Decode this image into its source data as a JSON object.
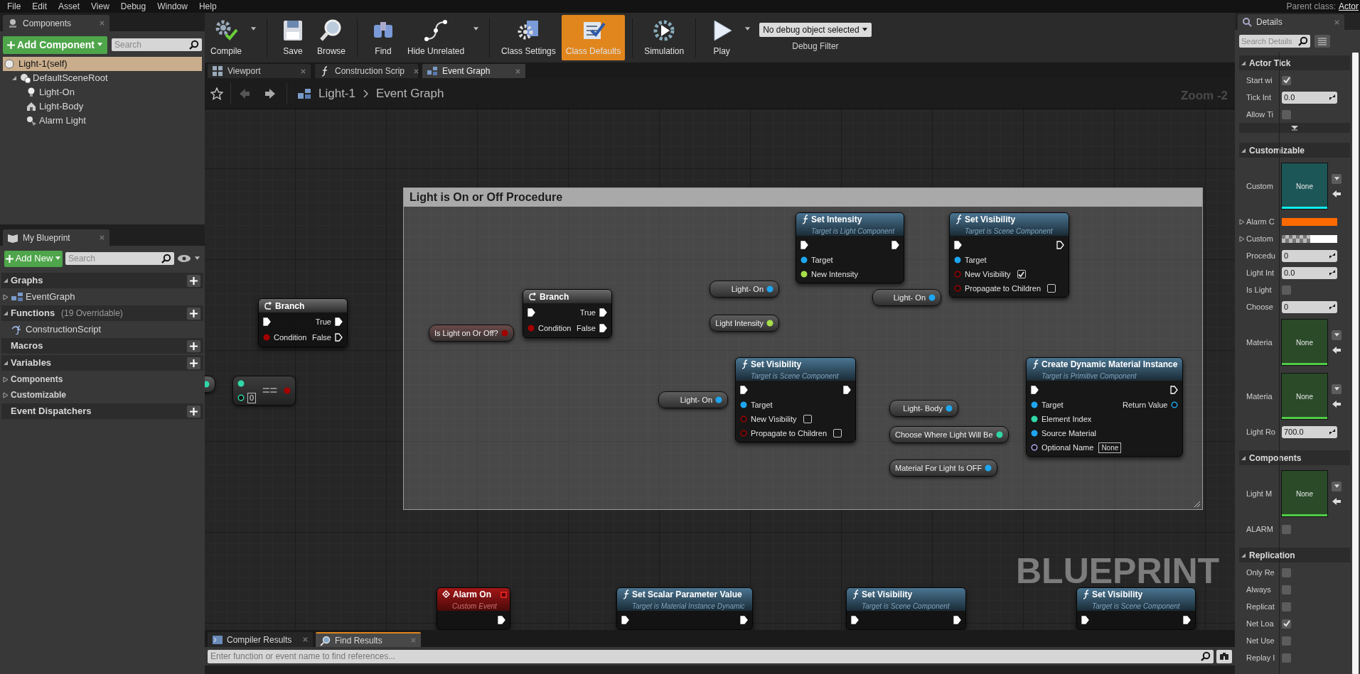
{
  "menu_bar": [
    "File",
    "Edit",
    "Asset",
    "View",
    "Debug",
    "Window",
    "Help"
  ],
  "parent_class": {
    "label": "Parent class:",
    "value": "Actor"
  },
  "components_panel": {
    "tab": "Components",
    "add_button": "Add Component",
    "search": {
      "placeholder": "Search"
    },
    "self_item": {
      "label": "Light-1(self)",
      "selected": true
    },
    "tree": [
      {
        "label": "DefaultSceneRoot",
        "kind": "scene",
        "expanded": true,
        "children": [
          {
            "label": "Light-On",
            "kind": "point_light"
          },
          {
            "label": "Light-Body",
            "kind": "mesh"
          },
          {
            "label": "Alarm Light",
            "kind": "spot_light"
          }
        ]
      }
    ]
  },
  "my_blueprint": {
    "tab": "My Blueprint",
    "add_button": "Add New",
    "search": {
      "placeholder": "Search"
    },
    "sections": [
      {
        "title": "Graphs",
        "items": [
          {
            "label": "EventGraph",
            "kind": "graph",
            "expandable": true
          }
        ]
      },
      {
        "title": "Functions",
        "note": "(19 Overridable)",
        "items": [
          {
            "label": "ConstructionScript",
            "kind": "function",
            "expandable": false
          }
        ]
      },
      {
        "title": "Macros"
      },
      {
        "title": "Variables",
        "items": [
          {
            "label": "Components",
            "kind": "category",
            "expandable": true
          },
          {
            "label": "Customizable",
            "kind": "category",
            "expandable": true
          }
        ]
      },
      {
        "title": "Event Dispatchers"
      }
    ]
  },
  "toolbar": [
    {
      "label": "Compile",
      "kind": "compile",
      "dropdown": true,
      "selected": false
    },
    {
      "label": "Save",
      "kind": "save",
      "dropdown": false,
      "selected": false
    },
    {
      "label": "Browse",
      "kind": "browse",
      "dropdown": false,
      "selected": false
    },
    {
      "label": "Find",
      "kind": "find",
      "dropdown": false,
      "selected": false
    },
    {
      "label": "Hide Unrelated",
      "kind": "hide",
      "dropdown": true,
      "selected": false
    },
    {
      "label": "Class Settings",
      "kind": "settings",
      "dropdown": false,
      "selected": false
    },
    {
      "label": "Class Defaults",
      "kind": "defaults",
      "dropdown": false,
      "selected": true
    },
    {
      "label": "Simulation",
      "kind": "simulation",
      "dropdown": false,
      "selected": false
    },
    {
      "label": "Play",
      "kind": "play",
      "dropdown": true,
      "selected": false
    }
  ],
  "debug_filter": {
    "value": "No debug object selected",
    "label": "Debug Filter"
  },
  "editor_tabs": [
    {
      "label": "Viewport",
      "kind": "viewport",
      "selected": false
    },
    {
      "label": "Construction Scrip",
      "kind": "function",
      "selected": false
    },
    {
      "label": "Event Graph",
      "kind": "graph",
      "selected": true
    }
  ],
  "breadcrumb": {
    "path": [
      "Light-1",
      "Event Graph"
    ],
    "zoom": "Zoom -2"
  },
  "graph": {
    "corner_label": "BLUEPRINT",
    "comment": {
      "title": "Light is On or Off Procedure"
    },
    "nodes": [
      {
        "kind": "variable",
        "outputs": [
          {
            "kind": "int",
            "connected": true
          }
        ]
      },
      {
        "kind": "branch",
        "title": "Branch",
        "inputs": [
          {
            "kind": "exec",
            "connected": true
          },
          {
            "label": "Condition",
            "kind": "bool",
            "connected": true
          }
        ],
        "outputs": [
          {
            "label": "True",
            "kind": "exec",
            "connected": true
          },
          {
            "label": "False",
            "kind": "exec",
            "connected": false
          }
        ]
      },
      {
        "kind": "compare",
        "symbol": "==",
        "inputs": [
          {
            "kind": "int",
            "connected": true
          },
          {
            "kind": "int",
            "connected": false,
            "value": "0"
          }
        ],
        "outputs": [
          {
            "kind": "bool",
            "connected": true
          }
        ]
      },
      {
        "kind": "variable",
        "title": "Is Light on Or Off?",
        "outputs": [
          {
            "kind": "bool",
            "connected": true
          }
        ]
      },
      {
        "kind": "branch",
        "title": "Branch",
        "inputs": [
          {
            "kind": "exec",
            "connected": true
          },
          {
            "label": "Condition",
            "kind": "bool",
            "connected": true
          }
        ],
        "outputs": [
          {
            "label": "True",
            "kind": "exec",
            "connected": true
          },
          {
            "label": "False",
            "kind": "exec",
            "connected": true
          }
        ]
      },
      {
        "kind": "function",
        "title": "Set Intensity",
        "subtitle": "Target is Light Component",
        "inputs": [
          {
            "kind": "exec",
            "connected": true
          },
          {
            "label": "Target",
            "kind": "object",
            "connected": true
          },
          {
            "label": "New Intensity",
            "kind": "float",
            "connected": true
          }
        ],
        "outputs": [
          {
            "kind": "exec",
            "connected": true
          }
        ]
      },
      {
        "kind": "variable",
        "title": "Light- On",
        "outputs": [
          {
            "kind": "object",
            "connected": true
          }
        ]
      },
      {
        "kind": "variable",
        "title": "Light Intensity",
        "outputs": [
          {
            "kind": "float",
            "connected": true
          }
        ]
      },
      {
        "kind": "function",
        "title": "Set Visibility",
        "subtitle": "Target is Scene Component",
        "inputs": [
          {
            "kind": "exec",
            "connected": true
          },
          {
            "label": "Target",
            "kind": "object",
            "connected": true
          },
          {
            "label": "New Visibility",
            "kind": "bool",
            "connected": false,
            "checked": true
          },
          {
            "label": "Propagate to Children",
            "kind": "bool",
            "connected": false,
            "checked": false
          }
        ],
        "outputs": [
          {
            "kind": "exec",
            "connected": false
          }
        ]
      },
      {
        "kind": "variable",
        "title": "Light- On",
        "outputs": [
          {
            "kind": "object",
            "connected": true
          }
        ]
      },
      {
        "kind": "variable",
        "title": "Light- On",
        "outputs": [
          {
            "kind": "object",
            "connected": true
          }
        ]
      },
      {
        "kind": "function",
        "title": "Set Visibility",
        "subtitle": "Target is Scene Component",
        "inputs": [
          {
            "kind": "exec",
            "connected": true
          },
          {
            "label": "Target",
            "kind": "object",
            "connected": true
          },
          {
            "label": "New Visibility",
            "kind": "bool",
            "connected": false,
            "checked": false
          },
          {
            "label": "Propagate to Children",
            "kind": "bool",
            "connected": false,
            "checked": false
          }
        ],
        "outputs": [
          {
            "kind": "exec",
            "connected": true
          }
        ]
      },
      {
        "kind": "variable",
        "title": "Light- Body",
        "outputs": [
          {
            "kind": "object",
            "connected": true
          }
        ]
      },
      {
        "kind": "variable",
        "title": "Choose Where Light Will Be",
        "outputs": [
          {
            "kind": "int",
            "connected": true
          }
        ]
      },
      {
        "kind": "variable",
        "title": "Material For Light Is OFF",
        "outputs": [
          {
            "kind": "object",
            "connected": true
          }
        ]
      },
      {
        "kind": "function",
        "title": "Create Dynamic Material Instance",
        "subtitle": "Target is Primitive Component",
        "inputs": [
          {
            "kind": "exec",
            "connected": true
          },
          {
            "label": "Target",
            "kind": "object",
            "connected": true
          },
          {
            "label": "Element Index",
            "kind": "int",
            "connected": true
          },
          {
            "label": "Source Material",
            "kind": "object",
            "connected": true
          },
          {
            "label": "Optional Name",
            "kind": "name",
            "connected": false,
            "value": "None"
          }
        ],
        "outputs": [
          {
            "kind": "exec",
            "connected": false
          },
          {
            "label": "Return Value",
            "kind": "object",
            "connected": false
          }
        ]
      },
      {
        "kind": "event",
        "title": "Alarm On",
        "subtitle": "Custom Event",
        "outputs": [
          {
            "kind": "exec",
            "connected": true
          }
        ]
      },
      {
        "kind": "function",
        "title": "Set Scalar Parameter Value",
        "subtitle": "Target is Material Instance Dynamic",
        "inputs": [
          {
            "kind": "exec",
            "connected": true
          }
        ],
        "outputs": [
          {
            "kind": "exec",
            "connected": true
          }
        ]
      },
      {
        "kind": "function",
        "title": "Set Visibility",
        "subtitle": "Target is Scene Component",
        "inputs": [
          {
            "kind": "exec",
            "connected": true
          }
        ],
        "outputs": [
          {
            "kind": "exec",
            "connected": true
          }
        ]
      },
      {
        "kind": "function",
        "title": "Set Visibility",
        "subtitle": "Target is Scene Component",
        "inputs": [
          {
            "kind": "exec",
            "connected": true
          }
        ],
        "outputs": [
          {
            "kind": "exec",
            "connected": true
          }
        ]
      }
    ]
  },
  "bottom_panel": {
    "tabs": [
      {
        "label": "Compiler Results",
        "kind": "compiler",
        "selected": false
      },
      {
        "label": "Find Results",
        "kind": "find",
        "selected": true
      }
    ],
    "search": {
      "placeholder": "Enter function or event name to find references..."
    }
  },
  "details": {
    "tab": "Details",
    "search": {
      "placeholder": "Search Details"
    },
    "sections": [
      {
        "title": "Actor Tick",
        "rows": [
          {
            "kind": "checkbox",
            "label": "Start wi",
            "checked": true
          },
          {
            "kind": "number",
            "label": "Tick Int",
            "value": "0.0"
          },
          {
            "kind": "checkbox",
            "label": "Allow Ti",
            "checked": false
          },
          {
            "kind": "more"
          }
        ]
      },
      {
        "title": "Customizable",
        "rows": [
          {
            "kind": "thumbnail",
            "label": "Custom",
            "value": "None",
            "color": "#1d5656"
          },
          {
            "kind": "color",
            "label": "Alarm C",
            "color": "#ff6a00"
          },
          {
            "kind": "texture",
            "label": "Custom"
          },
          {
            "kind": "number",
            "label": "Procedu",
            "value": "0"
          },
          {
            "kind": "number",
            "label": "Light Int",
            "value": "0.0"
          },
          {
            "kind": "checkbox",
            "label": "Is Light",
            "checked": false
          },
          {
            "kind": "number",
            "label": "Choose",
            "value": "0"
          },
          {
            "kind": "thumbnail",
            "label": "Materia",
            "value": "None",
            "color": "#2a4a28"
          },
          {
            "kind": "thumbnail",
            "label": "Materia",
            "value": "None",
            "color": "#2a4a28"
          },
          {
            "kind": "number",
            "label": "Light Ro",
            "value": "700.0"
          }
        ]
      },
      {
        "title": "Components",
        "rows": [
          {
            "kind": "thumbnail",
            "label": "Light M",
            "value": "None",
            "color": "#2a4a28"
          },
          {
            "kind": "checkbox",
            "label": "ALARM",
            "checked": false
          }
        ]
      },
      {
        "title": "Replication",
        "rows": [
          {
            "kind": "checkbox",
            "label": "Only Re",
            "checked": false
          },
          {
            "kind": "checkbox",
            "label": "Always",
            "checked": false
          },
          {
            "kind": "checkbox",
            "label": "Replicat",
            "checked": false
          },
          {
            "kind": "checkbox",
            "label": "Net Loa",
            "checked": true
          },
          {
            "kind": "checkbox",
            "label": "Net Use",
            "checked": false
          },
          {
            "kind": "checkbox",
            "label": "Replay I",
            "checked": false
          }
        ]
      }
    ]
  }
}
